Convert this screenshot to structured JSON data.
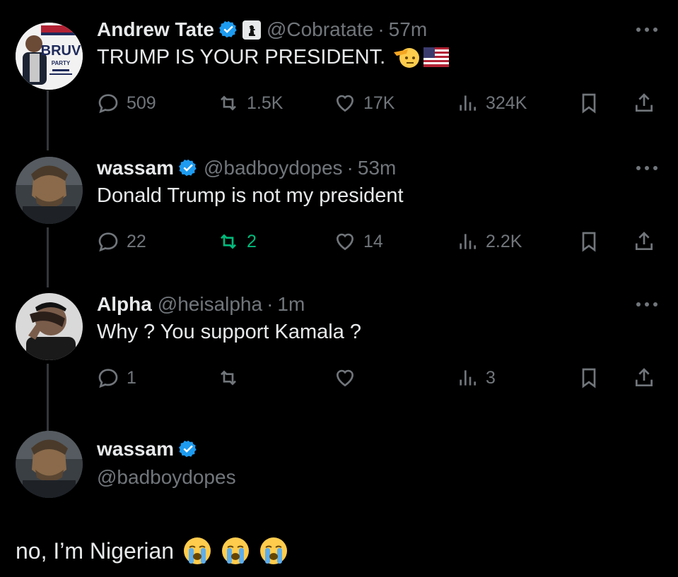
{
  "tweets": [
    {
      "name": "Andrew Tate",
      "handle": "@Cobratate",
      "time": "57m",
      "text": "TRUMP IS YOUR PRESIDENT.",
      "emojis": [
        "saluting-face",
        "us-flag"
      ],
      "avatar_text": "BRUV",
      "avatar_subtext": "PARTY",
      "replies": "509",
      "reposts": "1.5K",
      "likes": "17K",
      "views": "324K",
      "reposted": false
    },
    {
      "name": "wassam",
      "handle": "@badboydopes",
      "time": "53m",
      "text": "Donald Trump is not my president",
      "replies": "22",
      "reposts": "2",
      "likes": "14",
      "views": "2.2K",
      "reposted": true
    },
    {
      "name": "Alpha",
      "handle": "@heisalpha",
      "time": "1m",
      "text": "Why ? You support Kamala ?",
      "replies": "1",
      "reposts": "",
      "likes": "",
      "views": "3",
      "reposted": false
    }
  ],
  "reply": {
    "name": "wassam",
    "handle": "@badboydopes",
    "text": "no, I’m Nigerian",
    "emojis": [
      "loudly-crying-face",
      "loudly-crying-face",
      "loudly-crying-face"
    ]
  },
  "dot": "·",
  "colors": {
    "background": "#000000",
    "text": "#e7e9ea",
    "muted": "#71767b",
    "verified": "#1d9bf0",
    "repost_active": "#00ba7c",
    "thread_line": "#333639"
  }
}
